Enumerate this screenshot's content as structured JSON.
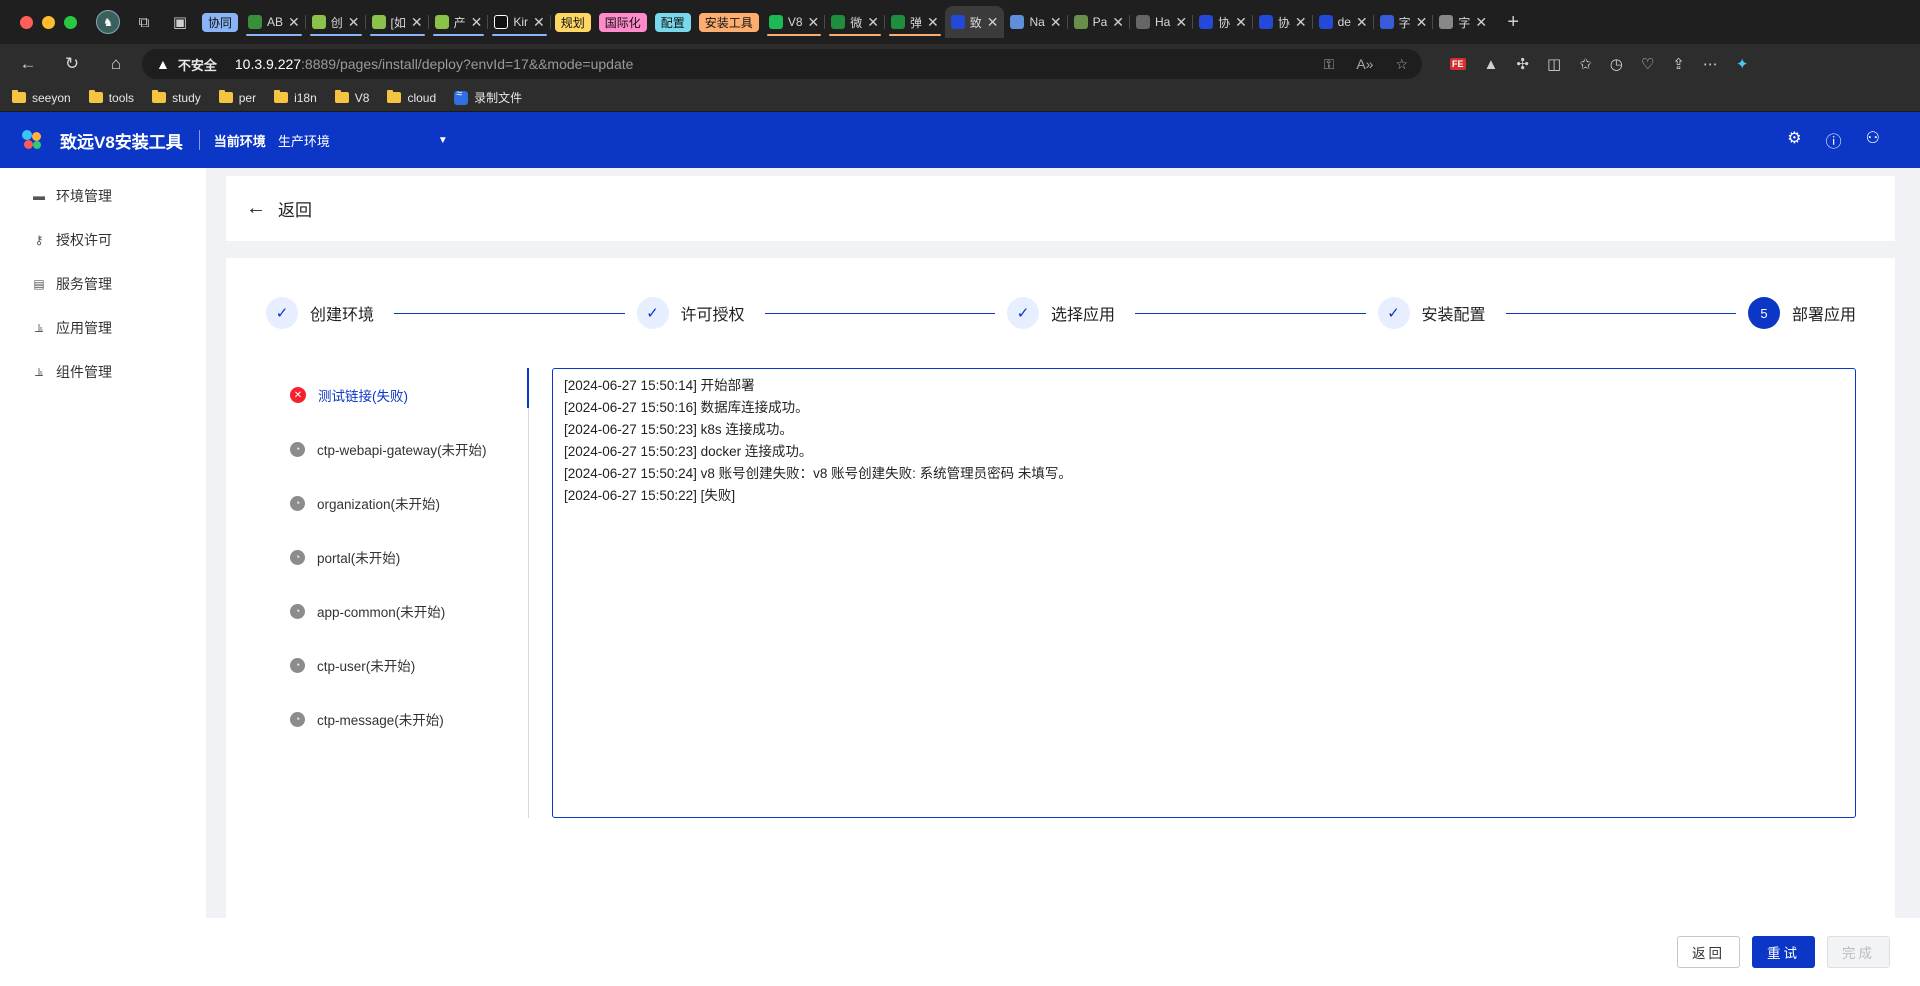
{
  "browser": {
    "tab_groups": [
      {
        "label": "协同",
        "color": "#8ab4f8"
      },
      {
        "label": "规划",
        "color": "#fdd663"
      },
      {
        "label": "国际化",
        "color": "#ff8bcb"
      },
      {
        "label": "配置",
        "color": "#78d9ec"
      },
      {
        "label": "安装工具",
        "color": "#fcad70"
      }
    ],
    "tabs": [
      {
        "label": "AB",
        "fav": "#3a8f3a"
      },
      {
        "label": "创",
        "fav": "#8bc34a"
      },
      {
        "label": "[如",
        "fav": "#8bc34a"
      },
      {
        "label": "产",
        "fav": "#8bc34a"
      },
      {
        "label": "Kir",
        "fav": "#111111"
      },
      {
        "label": "V8",
        "fav": "#1db954"
      },
      {
        "label": "微",
        "fav": "#1e8e3e"
      },
      {
        "label": "弹",
        "fav": "#1e8e3e"
      },
      {
        "label": "致",
        "fav": "#2449d8"
      },
      {
        "label": "Na",
        "fav": "#5e8fd8"
      },
      {
        "label": "Pa",
        "fav": "#6a8f4a"
      },
      {
        "label": "Ha",
        "fav": "#666666"
      },
      {
        "label": "协",
        "fav": "#2449d8"
      },
      {
        "label": "协",
        "fav": "#2449d8"
      },
      {
        "label": "de",
        "fav": "#2449d8"
      },
      {
        "label": "字",
        "fav": "#3a5bd9"
      },
      {
        "label": "字",
        "fav": "#888888"
      }
    ],
    "insecure_label": "不安全",
    "url_host": "10.3.9.227",
    "url_rest": ":8889/pages/install/deploy?envId=17&&mode=update",
    "bookmarks": [
      {
        "label": "seeyon",
        "type": "folder"
      },
      {
        "label": "tools",
        "type": "folder"
      },
      {
        "label": "study",
        "type": "folder"
      },
      {
        "label": "per",
        "type": "folder"
      },
      {
        "label": "i18n",
        "type": "folder"
      },
      {
        "label": "V8",
        "type": "folder"
      },
      {
        "label": "cloud",
        "type": "folder"
      },
      {
        "label": "录制文件",
        "type": "app"
      }
    ]
  },
  "app": {
    "title": "致远V8安装工具",
    "env_label": "当前环境",
    "env_value": "生产环境",
    "brand_color": "#0b36c6"
  },
  "sidebar": {
    "items": [
      {
        "label": "环境管理",
        "icon": "calendar-icon"
      },
      {
        "label": "授权许可",
        "icon": "key-icon"
      },
      {
        "label": "服务管理",
        "icon": "server-icon"
      },
      {
        "label": "应用管理",
        "icon": "chart-icon"
      },
      {
        "label": "组件管理",
        "icon": "chart-icon"
      }
    ]
  },
  "back": {
    "label": "返回"
  },
  "steps": [
    {
      "label": "创建环境",
      "status": "done"
    },
    {
      "label": "许可授权",
      "status": "done"
    },
    {
      "label": "选择应用",
      "status": "done"
    },
    {
      "label": "安装配置",
      "status": "done"
    },
    {
      "label": "部署应用",
      "status": "current",
      "number": "5"
    }
  ],
  "tasks": [
    {
      "label": "测试链接(失败)",
      "status": "fail"
    },
    {
      "label": "ctp-webapi-gateway(未开始)",
      "status": "pending"
    },
    {
      "label": "organization(未开始)",
      "status": "pending"
    },
    {
      "label": "portal(未开始)",
      "status": "pending"
    },
    {
      "label": "app-common(未开始)",
      "status": "pending"
    },
    {
      "label": "ctp-user(未开始)",
      "status": "pending"
    },
    {
      "label": "ctp-message(未开始)",
      "status": "pending"
    }
  ],
  "log": [
    "[2024-06-27 15:50:14] 开始部署",
    "[2024-06-27 15:50:16] 数据库连接成功。",
    "[2024-06-27 15:50:23] k8s 连接成功。",
    "[2024-06-27 15:50:23] docker 连接成功。",
    "[2024-06-27 15:50:24] v8 账号创建失败：v8 账号创建失败: 系统管理员密码 未填写。",
    "[2024-06-27 15:50:22] [失败]"
  ],
  "footer": {
    "back_label": "返回",
    "retry_label": "重试",
    "finish_label": "完成"
  }
}
